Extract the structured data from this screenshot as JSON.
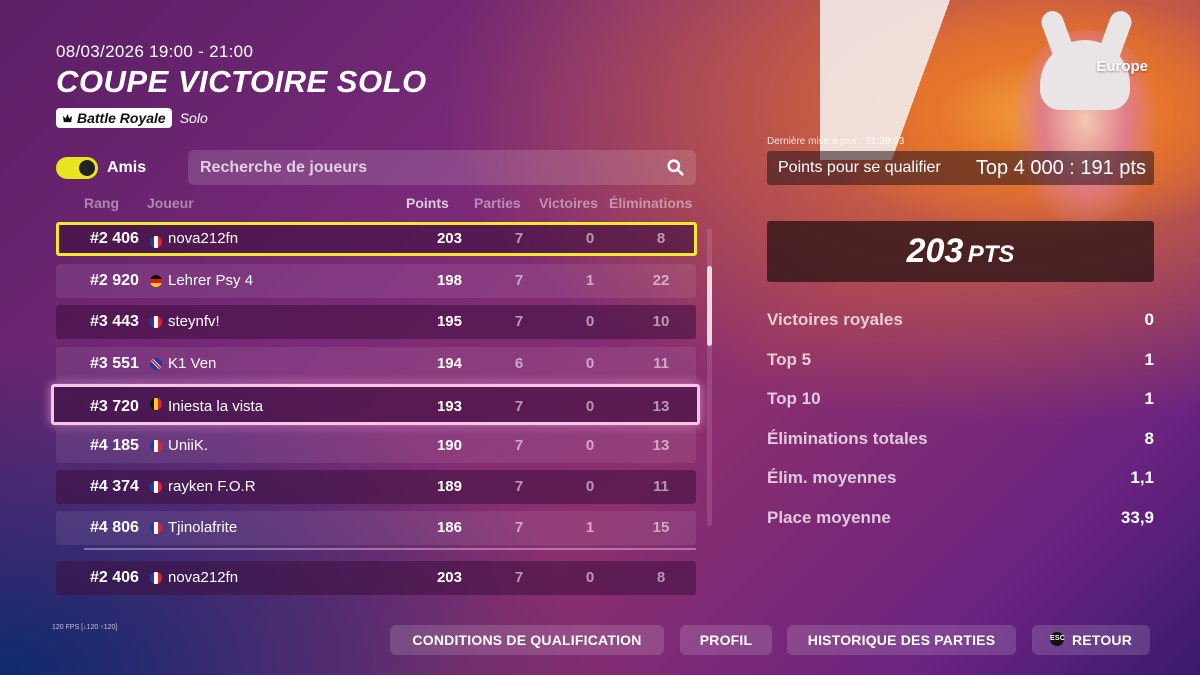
{
  "event": {
    "datetime": "08/03/2026 19:00 - 21:00",
    "title": "COUPE VICTOIRE SOLO",
    "mode_badge": "Battle Royale",
    "mode_type": "Solo",
    "region": "Europe"
  },
  "filters": {
    "friends_toggle_label": "Amis",
    "friends_toggle_on": true,
    "search_placeholder": "Recherche de joueurs"
  },
  "table": {
    "headers": {
      "rank": "Rang",
      "player": "Joueur",
      "points": "Points",
      "matches": "Parties",
      "wins": "Victoires",
      "elims": "Éliminations"
    },
    "rows": [
      {
        "rank": "#2 406",
        "flag": "fr",
        "player": "nova212fn",
        "points": "203",
        "matches": "7",
        "wins": "0",
        "elims": "8"
      },
      {
        "rank": "#2 920",
        "flag": "de",
        "player": "Lehrer Psy 4",
        "points": "198",
        "matches": "7",
        "wins": "1",
        "elims": "22"
      },
      {
        "rank": "#3 443",
        "flag": "fr",
        "player": "steynfv!",
        "points": "195",
        "matches": "7",
        "wins": "0",
        "elims": "10"
      },
      {
        "rank": "#3 551",
        "flag": "gb",
        "player": "K1 Ven",
        "points": "194",
        "matches": "6",
        "wins": "0",
        "elims": "11"
      },
      {
        "rank": "#3 720",
        "flag": "be",
        "player": "Iniesta la vista",
        "points": "193",
        "matches": "7",
        "wins": "0",
        "elims": "13"
      },
      {
        "rank": "#4 185",
        "flag": "fr",
        "player": "UniiK.",
        "points": "190",
        "matches": "7",
        "wins": "0",
        "elims": "13"
      },
      {
        "rank": "#4 374",
        "flag": "fr",
        "player": "rayken F.O.R",
        "points": "189",
        "matches": "7",
        "wins": "0",
        "elims": "11"
      },
      {
        "rank": "#4 806",
        "flag": "fr",
        "player": "Tjinolafrite",
        "points": "186",
        "matches": "7",
        "wins": "1",
        "elims": "15"
      }
    ],
    "self_row": {
      "rank": "#2 406",
      "flag": "fr",
      "player": "nova212fn",
      "points": "203",
      "matches": "7",
      "wins": "0",
      "elims": "8"
    }
  },
  "summary": {
    "last_update": "Dernière mise à jour : 21:39:03",
    "qualify_label": "Points pour se qualifier",
    "qualify_value": "Top 4 000 : 191 pts",
    "points_value": "203",
    "points_suffix": "PTS",
    "stats": [
      {
        "label": "Victoires royales",
        "value": "0"
      },
      {
        "label": "Top 5",
        "value": "1"
      },
      {
        "label": "Top 10",
        "value": "1"
      },
      {
        "label": "Éliminations totales",
        "value": "8"
      },
      {
        "label": "Élim. moyennes",
        "value": "1,1"
      },
      {
        "label": "Place moyenne",
        "value": "33,9"
      }
    ]
  },
  "footer": {
    "fps": "120 FPS [↓120 ↑120]",
    "btn_qualif": "CONDITIONS DE QUALIFICATION",
    "btn_profile": "PROFIL",
    "btn_history": "HISTORIQUE DES PARTIES",
    "btn_back_key": "ESC",
    "btn_back": "RETOUR"
  }
}
